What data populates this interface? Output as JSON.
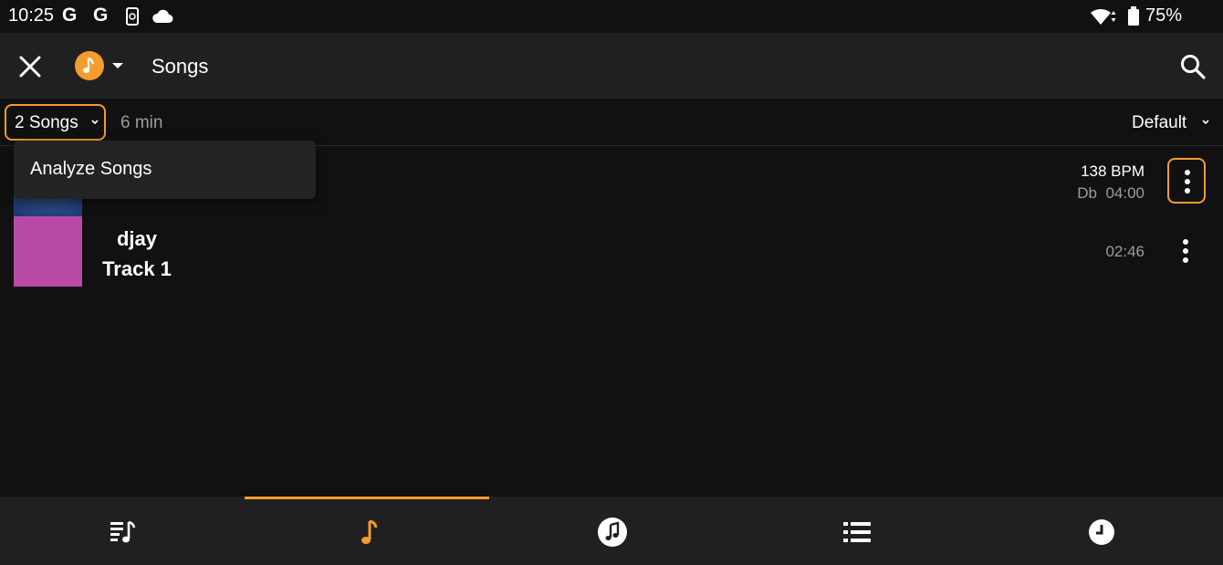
{
  "status_bar": {
    "time": "10:25",
    "notif_g1": "G",
    "notif_g2": "G",
    "battery": "75%"
  },
  "app_bar": {
    "title": "Songs",
    "source_icon": "music-note-icon",
    "accent": "#f39c2f"
  },
  "filter_bar": {
    "count_label": "2 Songs",
    "duration": "6 min",
    "sort_label": "Default"
  },
  "popup_menu": {
    "items": [
      {
        "label": "Analyze Songs"
      }
    ]
  },
  "songs": [
    {
      "title": "",
      "bpm": "138 BPM",
      "key": "Db",
      "duration": "04:00",
      "art_color": "#2a4a86"
    },
    {
      "title": "djay Track 1",
      "title_line1": "djay",
      "title_line2": "Track 1",
      "duration": "02:46",
      "art_color": "#b94ba6"
    }
  ],
  "bottom_nav": {
    "tabs": [
      {
        "icon": "playlist-music-icon",
        "active": false
      },
      {
        "icon": "music-note-icon",
        "active": true
      },
      {
        "icon": "music-circle-icon",
        "active": false
      },
      {
        "icon": "list-icon",
        "active": false
      },
      {
        "icon": "clock-icon",
        "active": false
      }
    ]
  }
}
